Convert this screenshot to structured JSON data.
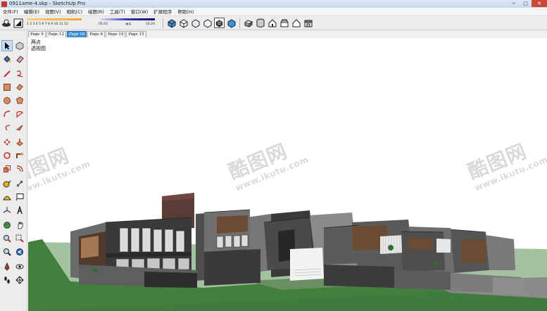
{
  "window": {
    "title": "0911ame-4.skp - SketchUp Pro",
    "minimize": "─",
    "maximize": "□",
    "close": "✕"
  },
  "menu": [
    "文件(F)",
    "编辑(E)",
    "视图(V)",
    "相机(C)",
    "绘图(R)",
    "工具(T)",
    "窗口(W)",
    "扩展程序",
    "帮助(H)"
  ],
  "shadow_settings": {
    "month_numbers": "1  2  3  4  5  6  7  8  9 10 11 12",
    "time_start": "05:43",
    "time_noon": "中午",
    "time_end": "16:24"
  },
  "scene_tabs": [
    "Page 9",
    "Page 12",
    "Page 18",
    "Page 6",
    "Page 14",
    "Page 15"
  ],
  "active_tab": "Page 18",
  "viewport": {
    "camera_line1": "两点",
    "camera_line2": "透视图"
  },
  "watermark": {
    "logo": "酷图网",
    "url": "www.ikutu.com"
  },
  "icons": {
    "toolbar": [
      "shadow-toggle-icon",
      "styles-icon",
      "xray-icon",
      "back-edges-icon",
      "wireframe-icon",
      "hidden-line-icon",
      "shaded-icon",
      "shaded-textures-icon",
      "iso-view-icon",
      "top-view-icon",
      "front-view-icon",
      "right-view-icon",
      "back-view-icon",
      "left-view-icon"
    ],
    "palette": [
      "select-icon",
      "component-icon",
      "paint-bucket-icon",
      "eraser-icon",
      "line-icon",
      "freehand-icon",
      "rectangle-icon",
      "rotated-rectangle-icon",
      "circle-icon",
      "polygon-icon",
      "arc-icon",
      "pie-icon",
      "two-point-arc-icon",
      "three-point-arc-icon",
      "move-icon",
      "push-pull-icon",
      "rotate-icon",
      "follow-me-icon",
      "scale-icon",
      "offset-icon",
      "tape-measure-icon",
      "dimension-icon",
      "protractor-icon",
      "text-icon",
      "axes-icon",
      "3d-text-icon",
      "orbit-icon",
      "pan-icon",
      "zoom-icon",
      "zoom-window-icon",
      "zoom-extents-icon",
      "previous-view-icon",
      "position-camera-icon",
      "look-around-icon",
      "walk-icon",
      "section-plane-icon"
    ]
  },
  "colors": {
    "active_tab": "#3f8fd6",
    "close_button": "#c94a3a",
    "ground": "#3e7a3c"
  }
}
